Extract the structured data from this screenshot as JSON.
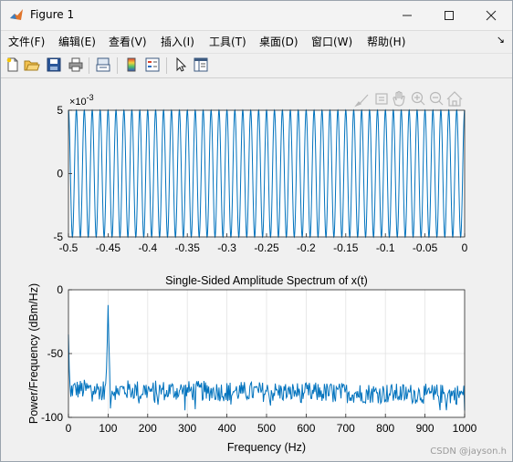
{
  "window": {
    "title": "Figure 1",
    "controls": {
      "minimize": "—",
      "maximize": "☐",
      "close": "✕"
    }
  },
  "menu": {
    "items": [
      "文件(F)",
      "编辑(E)",
      "查看(V)",
      "插入(I)",
      "工具(T)",
      "桌面(D)",
      "窗口(W)",
      "帮助(H)"
    ],
    "overflow_glyph": "↘"
  },
  "toolbar": {
    "icons": [
      "new-figure-icon",
      "open-file-icon",
      "save-icon",
      "print-icon",
      "link-icon",
      "insert-colorbar-icon",
      "insert-legend-icon",
      "pointer-icon",
      "property-inspector-icon"
    ]
  },
  "axes_toolbar": {
    "icons": [
      "brush-icon",
      "data-tips-icon",
      "pan-icon",
      "zoom-in-icon",
      "zoom-out-icon",
      "restore-view-icon"
    ]
  },
  "chart_data": [
    {
      "type": "line",
      "title": "",
      "xlabel": "",
      "ylabel": "",
      "xlim": [
        -0.5,
        0
      ],
      "ylim": [
        -0.005,
        0.005
      ],
      "exponent_label": "×10",
      "exponent_value": "-3",
      "xticks": [
        "-0.5",
        "-0.45",
        "-0.4",
        "-0.35",
        "-0.3",
        "-0.25",
        "-0.2",
        "-0.15",
        "-0.1",
        "-0.05",
        "0"
      ],
      "yticks": [
        "-5",
        "0",
        "5"
      ],
      "grid": false,
      "series": [
        {
          "amplitude": 0.005,
          "frequency_hz": 100,
          "color": "#0072bd"
        }
      ]
    },
    {
      "type": "line",
      "title": "Single-Sided Amplitude Spectrum of x(t)",
      "xlabel": "Frequency (Hz)",
      "ylabel": "Power/Frequency (dBm/Hz)",
      "xlim": [
        0,
        1000
      ],
      "ylim": [
        -100,
        0
      ],
      "xticks": [
        "0",
        "100",
        "200",
        "300",
        "400",
        "500",
        "600",
        "700",
        "800",
        "900",
        "1000"
      ],
      "yticks": [
        "0",
        "-50",
        "-100"
      ],
      "grid": true,
      "series": [
        {
          "color": "#0072bd",
          "peak": {
            "x": 100,
            "y": -12
          },
          "dc_value": -35,
          "noise_floor_range": [
            -92,
            -70
          ]
        }
      ]
    }
  ],
  "watermark": "CSDN @jayson.h"
}
